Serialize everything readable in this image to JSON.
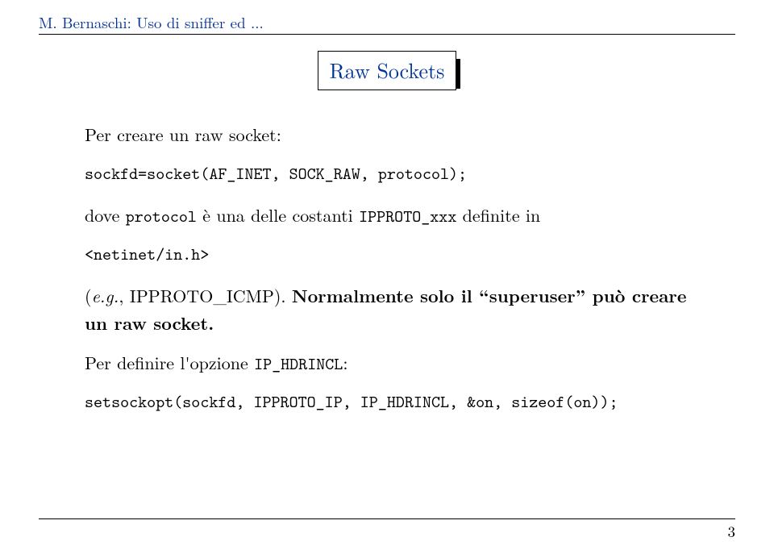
{
  "header": "M. Bernaschi: Uso di sniffer ed ...",
  "title": "Raw Sockets",
  "p1": "Per creare un raw socket:",
  "code1": "sockfd=socket(AF_INET, SOCK_RAW, protocol);",
  "p2a": "dove ",
  "p2_code": "protocol",
  "p2b": " è una delle costanti ",
  "p2_code2": "IPPROTO_xxx",
  "p2c": " definite in",
  "code2": "<netinet/in.h>",
  "p3a": "(",
  "p3_eg": "e.g.",
  "p3b": ", IPPROTO_ICMP). ",
  "p3_bold": "Normalmente solo il “superuser” può creare un raw socket.",
  "p4a": "Per definire l'opzione ",
  "p4_code": "IP_HDRINCL",
  "p4b": ":",
  "code3": "setsockopt(sockfd, IPPROTO_IP, IP_HDRINCL, &on, sizeof(on));",
  "page_num": "3"
}
